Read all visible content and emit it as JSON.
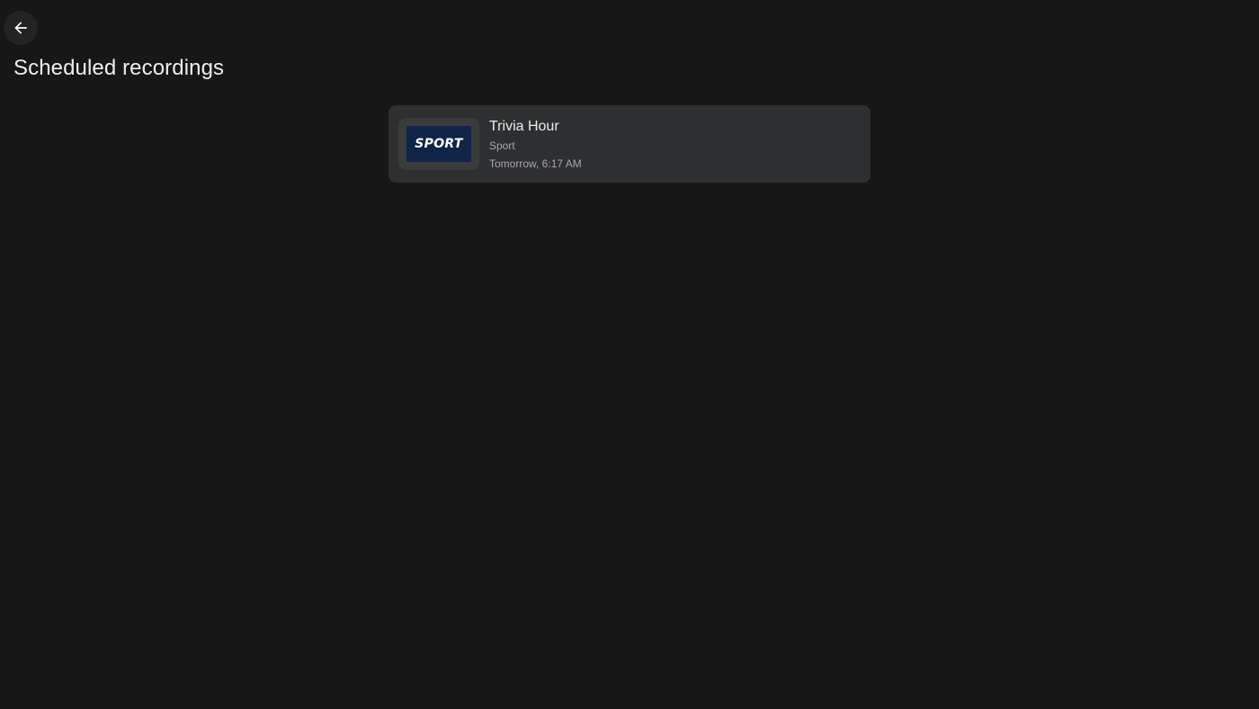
{
  "header": {
    "back_icon": "arrow-left-icon",
    "title": "Scheduled recordings"
  },
  "recordings": [
    {
      "title": "Trivia Hour",
      "channel": "Sport",
      "time": "Tomorrow, 6:17 AM",
      "logo_text": "SPORT",
      "logo_bg": "#0f2447"
    }
  ],
  "colors": {
    "background": "#171718",
    "card": "#2e2f31",
    "primary_text": "#eaeaea",
    "secondary_text": "#a8a8aa"
  }
}
